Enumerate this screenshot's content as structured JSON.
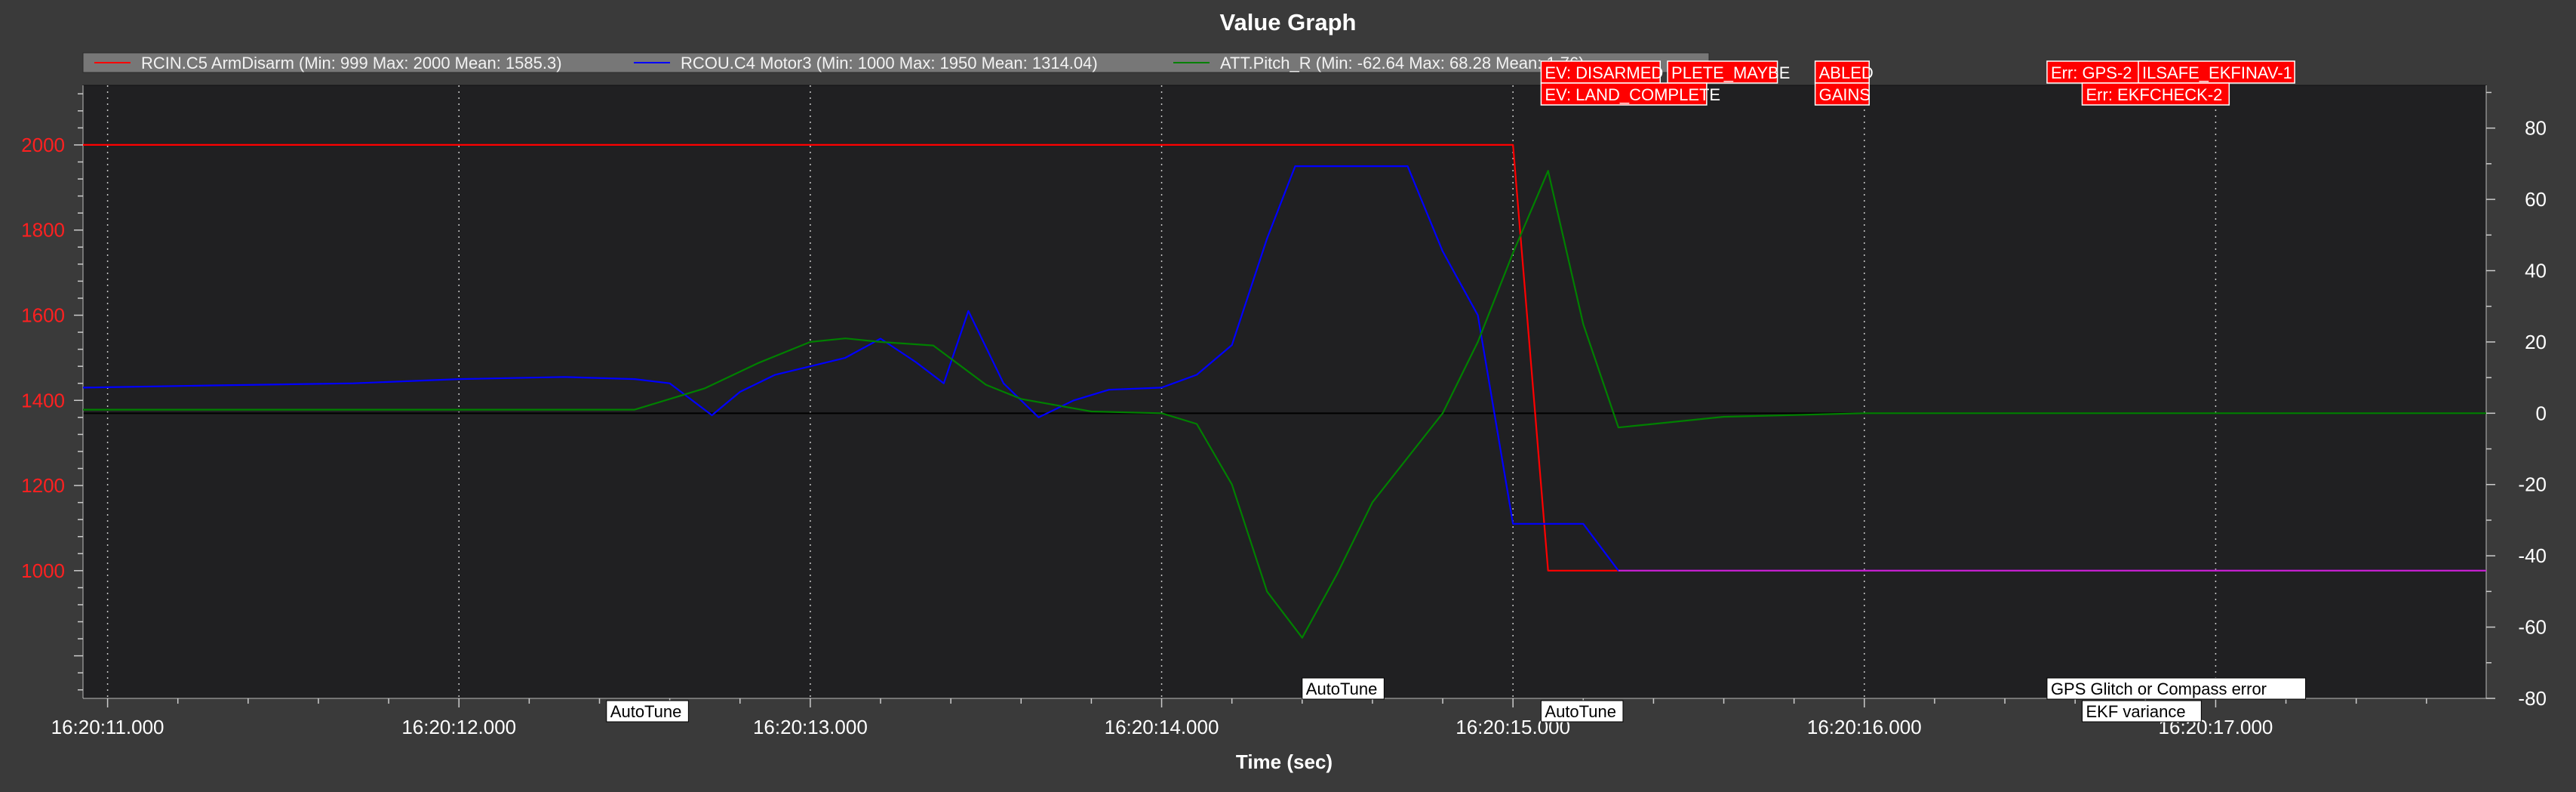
{
  "window": {
    "title": "Value Graph"
  },
  "legend": {
    "items": [
      {
        "label": "RCIN.C5 ArmDisarm (Min: 999 Max: 2000 Mean: 1585.3)",
        "color": "#ff0000"
      },
      {
        "label": "RCOU.C4 Motor3 (Min: 1000 Max: 1950 Mean: 1314.04)",
        "color": "#0000ff"
      },
      {
        "label": "ATT.Pitch_R (Min: -62.64 Max: 68.28 Mean: 1.76)",
        "color": "#008000"
      }
    ]
  },
  "chart_data": {
    "type": "line",
    "title": "Value Graph",
    "xlabel": "Time (sec)",
    "ylabel": "",
    "xlim": [
      10.93,
      17.77
    ],
    "ylim": [
      700,
      2140
    ],
    "y2lim": [
      -80,
      92
    ],
    "x_ticks": [
      {
        "value": 11,
        "label": "16:20:11.000"
      },
      {
        "value": 12,
        "label": "16:20:12.000"
      },
      {
        "value": 13,
        "label": "16:20:13.000"
      },
      {
        "value": 14,
        "label": "16:20:14.000"
      },
      {
        "value": 15,
        "label": "16:20:15.000"
      },
      {
        "value": 16,
        "label": "16:20:16.000"
      },
      {
        "value": 17,
        "label": "16:20:17.000"
      }
    ],
    "y_ticks": [
      1000,
      1200,
      1400,
      1600,
      1800,
      2000
    ],
    "y2_ticks": [
      -80,
      -60,
      -40,
      -20,
      0,
      20,
      40,
      60,
      80
    ],
    "grid": true,
    "legend_position": "top",
    "series": [
      {
        "name": "RCIN.C5 ArmDisarm (Min: 999 Max: 2000 Mean: 1585.3)",
        "color": "#ff0000",
        "axis": "left",
        "points": [
          [
            10.93,
            2000
          ],
          [
            15.0,
            2000
          ],
          [
            15.1,
            1000
          ],
          [
            17.77,
            1000
          ]
        ]
      },
      {
        "name": "RCOU.C4 Motor3 (Min: 1000 Max: 1950 Mean: 1314.04)",
        "color": "#0000ff",
        "axis": "left",
        "points": [
          [
            10.93,
            1430
          ],
          [
            11.3,
            1435
          ],
          [
            11.7,
            1440
          ],
          [
            12.0,
            1450
          ],
          [
            12.3,
            1455
          ],
          [
            12.5,
            1450
          ],
          [
            12.6,
            1440
          ],
          [
            12.72,
            1365
          ],
          [
            12.8,
            1420
          ],
          [
            12.9,
            1460
          ],
          [
            13.0,
            1480
          ],
          [
            13.1,
            1500
          ],
          [
            13.2,
            1545
          ],
          [
            13.3,
            1490
          ],
          [
            13.38,
            1440
          ],
          [
            13.45,
            1610
          ],
          [
            13.55,
            1440
          ],
          [
            13.65,
            1360
          ],
          [
            13.75,
            1400
          ],
          [
            13.85,
            1425
          ],
          [
            14.0,
            1430
          ],
          [
            14.1,
            1460
          ],
          [
            14.2,
            1530
          ],
          [
            14.3,
            1780
          ],
          [
            14.38,
            1950
          ],
          [
            14.6,
            1950
          ],
          [
            14.7,
            1950
          ],
          [
            14.8,
            1750
          ],
          [
            14.9,
            1600
          ],
          [
            15.0,
            1110
          ],
          [
            15.12,
            1110
          ],
          [
            15.2,
            1110
          ],
          [
            15.3,
            1000
          ],
          [
            17.77,
            1000
          ]
        ]
      },
      {
        "name": "ATT.Pitch_R (Min: -62.64 Max: 68.28 Mean: 1.76)",
        "color": "#008000",
        "axis": "right",
        "points": [
          [
            10.93,
            1.0
          ],
          [
            11.5,
            1.0
          ],
          [
            12.0,
            1.0
          ],
          [
            12.5,
            1.0
          ],
          [
            12.7,
            7.0
          ],
          [
            12.85,
            14.0
          ],
          [
            13.0,
            20.0
          ],
          [
            13.1,
            21.0
          ],
          [
            13.2,
            20.0
          ],
          [
            13.35,
            19.0
          ],
          [
            13.5,
            8.0
          ],
          [
            13.6,
            4.0
          ],
          [
            13.8,
            0.5
          ],
          [
            14.0,
            0.0
          ],
          [
            14.1,
            -3.0
          ],
          [
            14.2,
            -20.0
          ],
          [
            14.3,
            -50.0
          ],
          [
            14.4,
            -63.0
          ],
          [
            14.5,
            -45.0
          ],
          [
            14.6,
            -25.0
          ],
          [
            14.8,
            0.0
          ],
          [
            14.9,
            20.0
          ],
          [
            15.0,
            45.0
          ],
          [
            15.1,
            68.0
          ],
          [
            15.2,
            25.0
          ],
          [
            15.3,
            -4.0
          ],
          [
            15.4,
            -3.0
          ],
          [
            15.6,
            -1.0
          ],
          [
            16.0,
            0.0
          ],
          [
            17.0,
            0.0
          ],
          [
            17.77,
            0.0
          ]
        ]
      }
    ],
    "events_top": [
      {
        "label": "EV: DISARMED",
        "x": 15.08,
        "row": 0
      },
      {
        "label": "PLETE_MAYBE",
        "x": 15.44,
        "row": 0
      },
      {
        "label": "ABLED",
        "x": 15.86,
        "row": 0
      },
      {
        "label": "EV: LAND_COMPLETE",
        "x": 15.08,
        "row": 1
      },
      {
        "label": "GAINS",
        "x": 15.86,
        "row": 1
      },
      {
        "label": "Err: GPS-2",
        "x": 16.52,
        "row": 0
      },
      {
        "label": "ILSAFE_EKFINAV-1",
        "x": 16.78,
        "row": 0
      },
      {
        "label": "Err: EKFCHECK-2",
        "x": 16.62,
        "row": 1
      }
    ],
    "events_bottom": [
      {
        "label": "AutoTune",
        "x": 14.4,
        "row": 0
      },
      {
        "label": "AutoTune",
        "x": 12.42,
        "row": 1
      },
      {
        "label": "AutoTune",
        "x": 15.08,
        "row": 1
      },
      {
        "label": "GPS Glitch or Compass error",
        "x": 16.52,
        "row": 0
      },
      {
        "label": "EKF variance",
        "x": 16.62,
        "row": 1
      }
    ]
  }
}
